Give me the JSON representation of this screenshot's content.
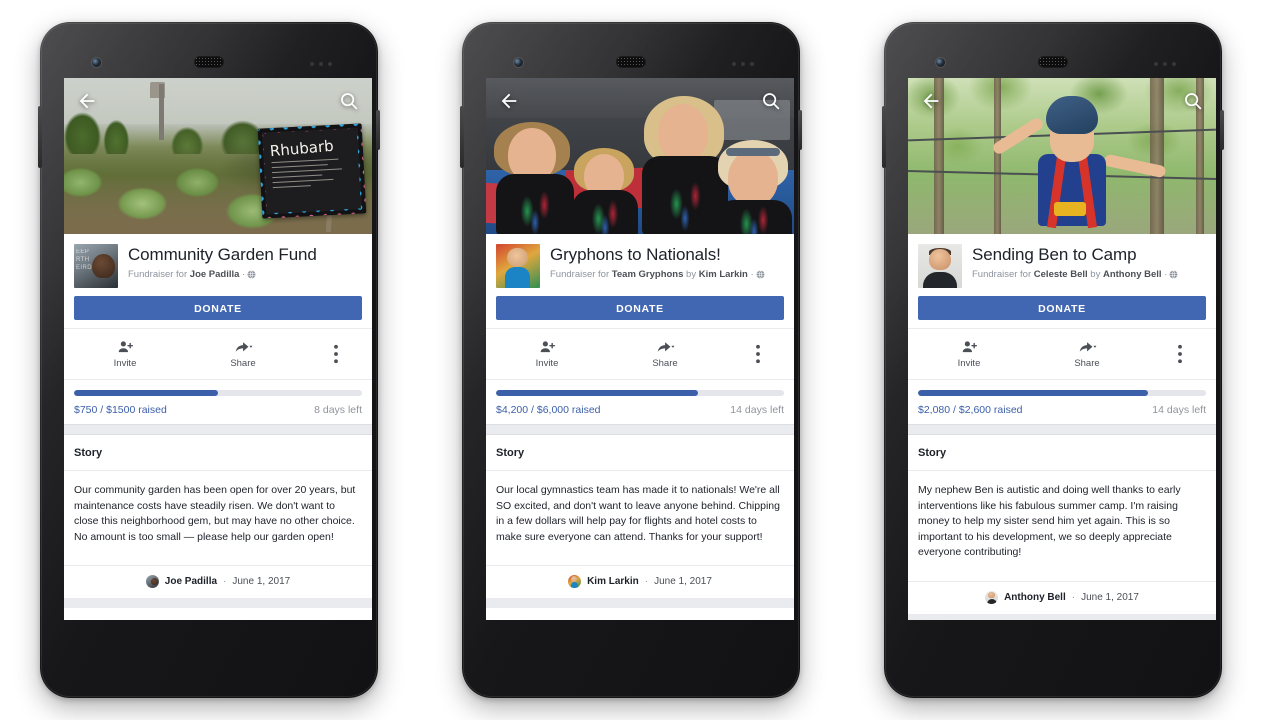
{
  "meta": {
    "scene": "Three Android phones showing Facebook Fundraiser pages",
    "background_color": "#ffffff",
    "accent_color": "#4267b2",
    "progress_fill_color": "#3b5fa8",
    "progress_track_color": "#e4e6eb"
  },
  "phones": [
    {
      "id": "phone-1",
      "hero": {
        "photo_name": "community-garden-photo",
        "sign_word": "Rhubarb"
      },
      "topbar": {
        "back_icon": "back-arrow-icon",
        "search_icon": "search-icon"
      },
      "fundraiser": {
        "avatar_name": "joe-padilla-avatar",
        "avatar_mural_text": "KEEP\nEARTH\nWEIRD",
        "title": "Community Garden Fund",
        "subtitle_prefix": "Fundraiser for",
        "beneficiary": "Joe Padilla",
        "privacy_icon": "globe-icon",
        "donate_label": "DONATE"
      },
      "actions": [
        {
          "icon": "invite-person-add-icon",
          "label": "Invite"
        },
        {
          "icon": "share-arrow-icon",
          "label": "Share",
          "has_caret": true
        },
        {
          "icon": "overflow-kebab-icon",
          "label": ""
        }
      ],
      "progress": {
        "raised_text": "$750 / $1500 raised",
        "time_left": "8 days left",
        "raised_amount": 750,
        "goal_amount": 1500,
        "percent": 50
      },
      "story": {
        "heading": "Story",
        "text": "Our community garden has been open for over 20 years, but maintenance costs have steadily risen. We don't want to close this neighborhood gem, but may have no other choice. No amount is too small — please help our garden open!",
        "author": "Joe Padilla",
        "separator": "·",
        "date": "June 1, 2017",
        "author_avatar_name": "joe-padilla-mini-avatar"
      }
    },
    {
      "id": "phone-2",
      "hero": {
        "photo_name": "gymnastics-team-photo",
        "sign_word": ""
      },
      "topbar": {
        "back_icon": "back-arrow-icon",
        "search_icon": "search-icon"
      },
      "fundraiser": {
        "avatar_name": "kim-larkin-avatar",
        "avatar_mural_text": "",
        "title": "Gryphons to Nationals!",
        "subtitle_prefix": "Fundraiser for",
        "beneficiary": "Team Gryphons",
        "by_prefix": "by",
        "organizer": "Kim Larkin",
        "privacy_icon": "globe-icon",
        "donate_label": "DONATE"
      },
      "actions": [
        {
          "icon": "invite-person-add-icon",
          "label": "Invite"
        },
        {
          "icon": "share-arrow-icon",
          "label": "Share",
          "has_caret": true
        },
        {
          "icon": "overflow-kebab-icon",
          "label": ""
        }
      ],
      "progress": {
        "raised_text": "$4,200 / $6,000 raised",
        "time_left": "14 days left",
        "raised_amount": 4200,
        "goal_amount": 6000,
        "percent": 70
      },
      "story": {
        "heading": "Story",
        "text": "Our local gymnastics team has made it to nationals! We're all SO excited, and don't want to leave anyone behind. Chipping in a few dollars will help pay for flights and hotel costs to make sure everyone can attend. Thanks for your support!",
        "author": "Kim Larkin",
        "separator": "·",
        "date": "June 1, 2017",
        "author_avatar_name": "kim-larkin-mini-avatar"
      }
    },
    {
      "id": "phone-3",
      "hero": {
        "photo_name": "boy-ropes-course-photo",
        "sign_word": ""
      },
      "topbar": {
        "back_icon": "back-arrow-icon",
        "search_icon": "search-icon"
      },
      "fundraiser": {
        "avatar_name": "anthony-bell-avatar",
        "avatar_mural_text": "",
        "title": "Sending Ben to Camp",
        "subtitle_prefix": "Fundraiser for",
        "beneficiary": "Celeste Bell",
        "by_prefix": "by",
        "organizer": "Anthony Bell",
        "privacy_icon": "globe-icon",
        "donate_label": "DONATE"
      },
      "actions": [
        {
          "icon": "invite-person-add-icon",
          "label": "Invite"
        },
        {
          "icon": "share-arrow-icon",
          "label": "Share",
          "has_caret": true
        },
        {
          "icon": "overflow-kebab-icon",
          "label": ""
        }
      ],
      "progress": {
        "raised_text": "$2,080 / $2,600 raised",
        "time_left": "14 days left",
        "raised_amount": 2080,
        "goal_amount": 2600,
        "percent": 80
      },
      "story": {
        "heading": "Story",
        "text": "My nephew Ben is autistic and doing well thanks to early interventions like his fabulous summer camp. I'm raising money to help my sister send him yet again. This is so important to his development, we so deeply appreciate everyone contributing!",
        "author": "Anthony Bell",
        "separator": "·",
        "date": "June 1, 2017",
        "author_avatar_name": "anthony-bell-mini-avatar"
      }
    }
  ]
}
